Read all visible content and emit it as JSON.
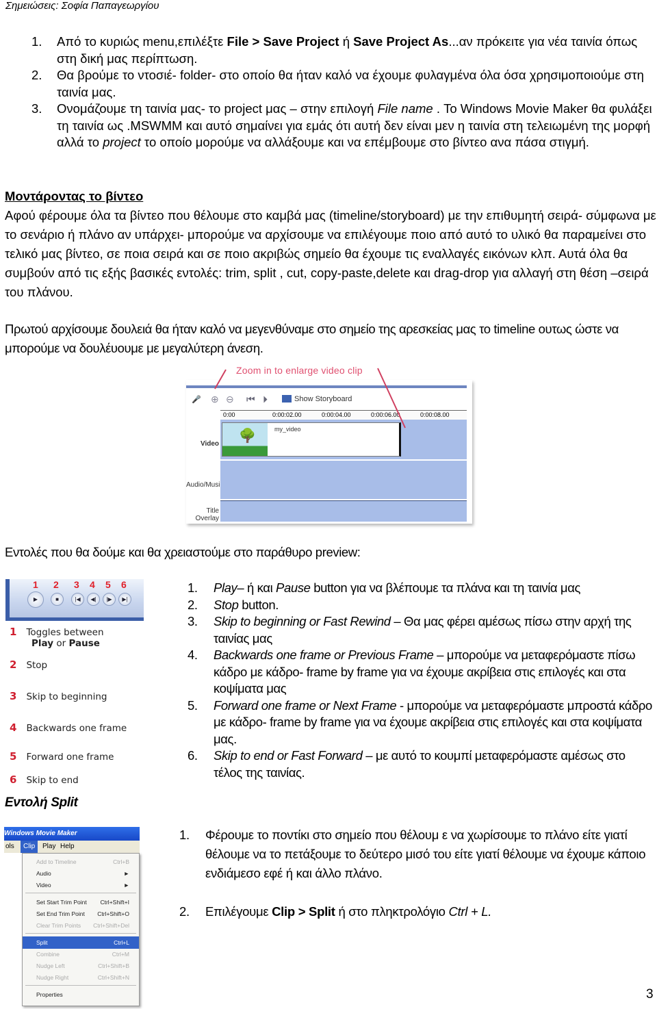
{
  "header": "Σημειώσεις: Σοφία Παπαγεωργίου",
  "save_steps": [
    {
      "num": "1.",
      "parts": [
        {
          "t": "Από το κυριώς  menu,επιλέξτε ",
          "s": ""
        },
        {
          "t": "File > Save Project",
          "s": "b"
        },
        {
          "t": " ή ",
          "s": ""
        },
        {
          "t": "Save Project As",
          "s": "b"
        },
        {
          "t": "...αν πρόκειτε για νέα ταινία όπως στη δική μας περίπτωση.",
          "s": ""
        }
      ]
    },
    {
      "num": "2.",
      "parts": [
        {
          "t": "Θα βρούμε το ντοσιέ- folder- στο οποίο θα ήταν καλό να έχουμε φυλαγμένα όλα όσα χρησιμοποιούμε στη ταινία μας.",
          "s": ""
        }
      ]
    },
    {
      "num": "3.",
      "parts": [
        {
          "t": "Ονομάζουμε τη ταινία μας- το project μας – στην επιλογή ",
          "s": ""
        },
        {
          "t": "File name",
          "s": "i"
        },
        {
          "t": " . Το Windows Movie Maker θα φυλάξει τη ταινία ως .MSWMM και αυτό σημαίνει για εμάς ότι αυτή δεν είναι μεν η ταινία στη τελειωμένη της μορφή αλλά το ",
          "s": ""
        },
        {
          "t": "project",
          "s": "i"
        },
        {
          "t": " το οποίο μορούμε να αλλάξουμε και να επέμβουμε στο βίντεο  ανα πάσα στιγμή.",
          "s": ""
        }
      ]
    }
  ],
  "editing": {
    "heading": "Μοντάροντας το βίντεο",
    "paragraph": "Αφού φέρουμε όλα τα βίντεο που θέλουμε στο καμβά μας (timeline/storyboard) με την επιθυμητή σειρά- σύμφωνα με το σενάριο ή πλάνο αν υπάρχει- μπορούμε να αρχίσουμε να επιλέγουμε ποιο από αυτό το υλικό θα παραμείνει στο τελικό μας βίντεο, σε ποια σειρά και σε ποιο ακριβώς σημείο θα έχουμε τις εναλλαγές εικόνων κλπ. Αυτά όλα θα συμβούν από τις εξής βασικές εντολές: trim, split , cut, copy-paste,delete και drag-drop για αλλαγή στη θέση –σειρά του πλάνου.",
    "zoom_paragraph": "Πρωτού αρχίσουμε δουλειά θα ήταν καλό να μεγενθύναμε στο σημείο της αρεσκείας μας το timeline ουτως ώστε να μπορούμε να δουλέυουμε με μεγαλύτερη άνεση."
  },
  "timeline_image": {
    "caption": "Zoom in to enlarge video clip",
    "show_storyboard": "Show Storyboard",
    "ruler": [
      "0:00",
      "0:00:02.00",
      "0:00:04.00",
      "0:00:06.00",
      "0:00:08.00"
    ],
    "tracks": [
      "Video",
      "Audio/Music",
      "Title Overlay"
    ],
    "clip_name": "my_video"
  },
  "preview_intro": "Εντολές που θα δούμε και θα χρειαστούμε στο παράθυρο preview:",
  "player_image": {
    "numbers": [
      "1",
      "2",
      "3",
      "4",
      "5",
      "6"
    ],
    "buttons": [
      "▶",
      "■",
      "|◀",
      "◀|",
      "|▶",
      "▶|"
    ],
    "legend": [
      {
        "n": "1",
        "text": "Toggles between",
        "bold1": "Play",
        "or": "or",
        "bold2": "Pause"
      },
      {
        "n": "2",
        "text": "Stop"
      },
      {
        "n": "3",
        "text": "Skip to beginning"
      },
      {
        "n": "4",
        "text": "Backwards one frame"
      },
      {
        "n": "5",
        "text": "Forward one frame"
      },
      {
        "n": "6",
        "text": "Skip to end"
      }
    ]
  },
  "preview_list": [
    {
      "num": "1.",
      "parts": [
        {
          "t": "Play",
          "s": "i"
        },
        {
          "t": "– ή και ",
          "s": ""
        },
        {
          "t": "Pause",
          "s": "i"
        },
        {
          "t": " button για να βλέπουμε τα πλάνα και τη ταινία μας",
          "s": ""
        }
      ]
    },
    {
      "num": "2.",
      "parts": [
        {
          "t": "Stop",
          "s": "i"
        },
        {
          "t": " button.",
          "s": ""
        }
      ]
    },
    {
      "num": "3.",
      "parts": [
        {
          "t": "Skip to beginning or Fast Rewind",
          "s": "i"
        },
        {
          "t": " – Θα μας φέρει αμέσως πίσω στην αρχή της ταινίας μας",
          "s": ""
        }
      ]
    },
    {
      "num": "4.",
      "parts": [
        {
          "t": "Backwards one frame or Previous Frame",
          "s": "i"
        },
        {
          "t": " – μπορούμε να μεταφερόμαστε πίσω κάδρο με κάδρο- frame by frame για να έχουμε ακρίβεια στις επιλογές και στα κοψίματα μας",
          "s": ""
        }
      ]
    },
    {
      "num": "5.",
      "parts": [
        {
          "t": "Forward one frame or Next Frame",
          "s": "i"
        },
        {
          "t": " - μπορούμε να μεταφερόμαστε μπροστά κάδρο με κάδρο- frame by frame για να έχουμε ακρίβεια στις επιλογές και στα κοψίματα μας.",
          "s": ""
        }
      ]
    },
    {
      "num": "6.",
      "parts": [
        {
          "t": "Skip to end or Fast Forward",
          "s": "i"
        },
        {
          "t": " – με αυτό το κουμπί μεταφερόμαστε αμέσως στο τέλος της ταινίας.",
          "s": ""
        }
      ]
    }
  ],
  "split": {
    "heading": "Εντολή Split",
    "steps": [
      {
        "num": "1.",
        "parts": [
          {
            "t": "Φέρουμε το ποντίκι στο σημείο που θέλουμ ε να χωρίσουμε το πλάνο είτε γιατί θέλουμε να το πετάξουμε το δεύτερο μισό του είτε γιατί θέλουμε να έχουμε κάποιο ενδιάμεσο εφέ ή και άλλο πλάνο.",
            "s": ""
          }
        ]
      },
      {
        "num": "2.",
        "parts": [
          {
            "t": "Επιλέγουμε ",
            "s": ""
          },
          {
            "t": "Clip > Split",
            "s": "b"
          },
          {
            "t": " ή στο πληκτρολόγιο  ",
            "s": ""
          },
          {
            "t": "Ctrl + L.",
            "s": "i"
          }
        ]
      }
    ]
  },
  "menu_image": {
    "title": "Windows Movie Maker",
    "menubar": [
      "ols",
      "Clip",
      "Play",
      "Help"
    ],
    "items": [
      {
        "label": "Add to Timeline",
        "shortcut": "Ctrl+B",
        "state": "disabled"
      },
      {
        "label": "Audio",
        "shortcut": "►",
        "state": ""
      },
      {
        "label": "Video",
        "shortcut": "►",
        "state": ""
      },
      {
        "sep": true
      },
      {
        "label": "Set Start Trim Point",
        "shortcut": "Ctrl+Shift+I",
        "state": ""
      },
      {
        "label": "Set End Trim Point",
        "shortcut": "Ctrl+Shift+O",
        "state": ""
      },
      {
        "label": "Clear Trim Points",
        "shortcut": "Ctrl+Shift+Del",
        "state": "disabled"
      },
      {
        "sep": true
      },
      {
        "label": "Split",
        "shortcut": "Ctrl+L",
        "state": "selected"
      },
      {
        "label": "Combine",
        "shortcut": "Ctrl+M",
        "state": "disabled"
      },
      {
        "label": "Nudge Left",
        "shortcut": "Ctrl+Shift+B",
        "state": "disabled"
      },
      {
        "label": "Nudge Right",
        "shortcut": "Ctrl+Shift+N",
        "state": "disabled"
      },
      {
        "sep": true
      },
      {
        "label": "Properties",
        "shortcut": "",
        "state": ""
      }
    ]
  },
  "page_number": "3"
}
